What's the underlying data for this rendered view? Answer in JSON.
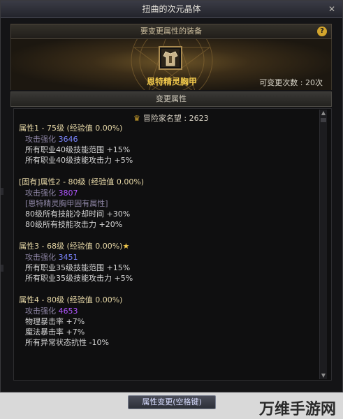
{
  "window": {
    "title": "扭曲的次元晶体"
  },
  "equip": {
    "header": "要变更属性的装备",
    "name": "恩特精灵胸甲",
    "change_count": "可变更次数 : 20次"
  },
  "change_header": "变更属性",
  "fame": {
    "label": "冒险家名望 : 2623"
  },
  "attributes": [
    {
      "title": "属性1 - 75级 (经验值 0.00%)",
      "lines": [
        {
          "label": "攻击强化",
          "value": "3646",
          "value_color": "blue"
        },
        {
          "text": "所有职业40级技能范围 +15%"
        },
        {
          "text": "所有职业40级技能攻击力 +5%"
        }
      ]
    },
    {
      "title": "[固有]属性2 - 80级 (经验值 0.00%)",
      "lines": [
        {
          "label": "攻击强化",
          "value": "3807",
          "value_color": "purple"
        },
        {
          "text": "[恩特精灵胸甲固有属性]",
          "muted": true
        },
        {
          "text": "80级所有技能冷却时间 +30%"
        },
        {
          "text": "80级所有技能攻击力 +20%"
        }
      ]
    },
    {
      "title": "属性3 - 68级 (经验值 0.00%)",
      "star": "★",
      "lines": [
        {
          "label": "攻击强化",
          "value": "3451",
          "value_color": "blue"
        },
        {
          "text": "所有职业35级技能范围 +15%"
        },
        {
          "text": "所有职业35级技能攻击力 +5%"
        }
      ]
    },
    {
      "title": "属性4 - 80级 (经验值 0.00%)",
      "lines": [
        {
          "label": "攻击强化",
          "value": "4653",
          "value_color": "purple"
        },
        {
          "text": "物理暴击率 +7%"
        },
        {
          "text": "魔法暴击率 +7%"
        },
        {
          "text": "所有异常状态抗性 -10%"
        }
      ]
    }
  ],
  "footer": {
    "apply_button": "属性变更(空格键)"
  },
  "watermark": "万维手游网"
}
